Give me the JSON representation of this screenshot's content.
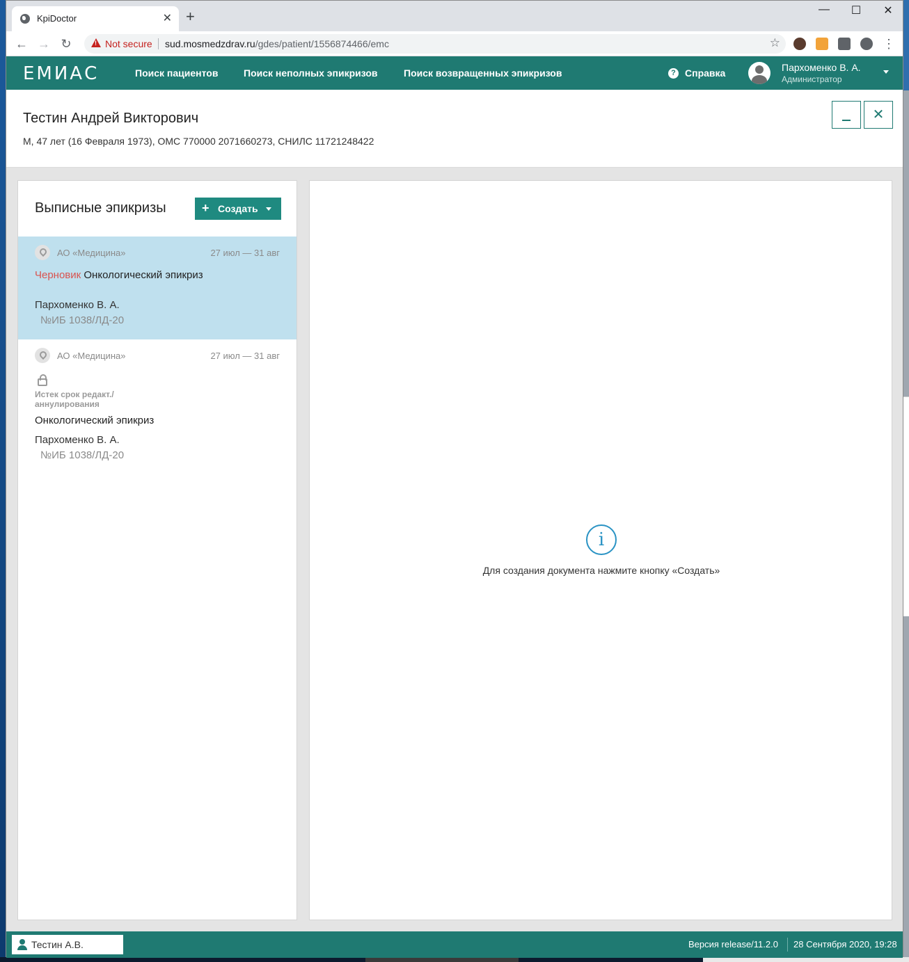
{
  "browser": {
    "tab_title": "KpiDoctor",
    "tab_close": "✕",
    "new_tab": "+",
    "security_label": "Not secure",
    "url_host": "sud.mosmedzdrav.ru",
    "url_path": "/gdes/patient/1556874466/emc",
    "window_controls": {
      "minimize": "—",
      "maximize": "☐",
      "close": "✕"
    }
  },
  "app": {
    "logo": "ЕМИАС",
    "nav": [
      "Поиск пациентов",
      "Поиск неполных эпикризов",
      "Поиск возвращенных эпикризов"
    ],
    "help_label": "Справка",
    "user": {
      "name": "Пархоменко В. А.",
      "role": "Администратор"
    },
    "accent_color": "#1f7a72"
  },
  "patient": {
    "name": "Тестин Андрей Викторович",
    "info": "М, 47 лет (16 Февраля 1973), ОМС 770000 2071660273, СНИЛС 11721248422"
  },
  "left_panel": {
    "title": "Выписные эпикризы",
    "create_button": "Создать",
    "documents": [
      {
        "org": "АО «Медицина»",
        "dates": "27 июл — 31 авг",
        "status": "Черновик",
        "title": "Онкологический эпикриз",
        "author": "Пархоменко В. А.",
        "ib": "№ИБ 1038/ЛД-20",
        "selected": true
      },
      {
        "org": "АО «Медицина»",
        "dates": "27 июл — 31 авг",
        "lock_note": "Истек срок редакт./ аннулирования",
        "title": "Онкологический эпикриз",
        "author": "Пархоменко В. А.",
        "ib": "№ИБ 1038/ЛД-20",
        "selected": false
      }
    ]
  },
  "right_panel": {
    "empty_icon": "i",
    "empty_message": "Для создания документа нажмите кнопку «Создать»"
  },
  "footer": {
    "patient_chip": "Тестин А.В.",
    "version": "Версия release/11.2.0",
    "datetime": "28 Сентября 2020, 19:28"
  }
}
